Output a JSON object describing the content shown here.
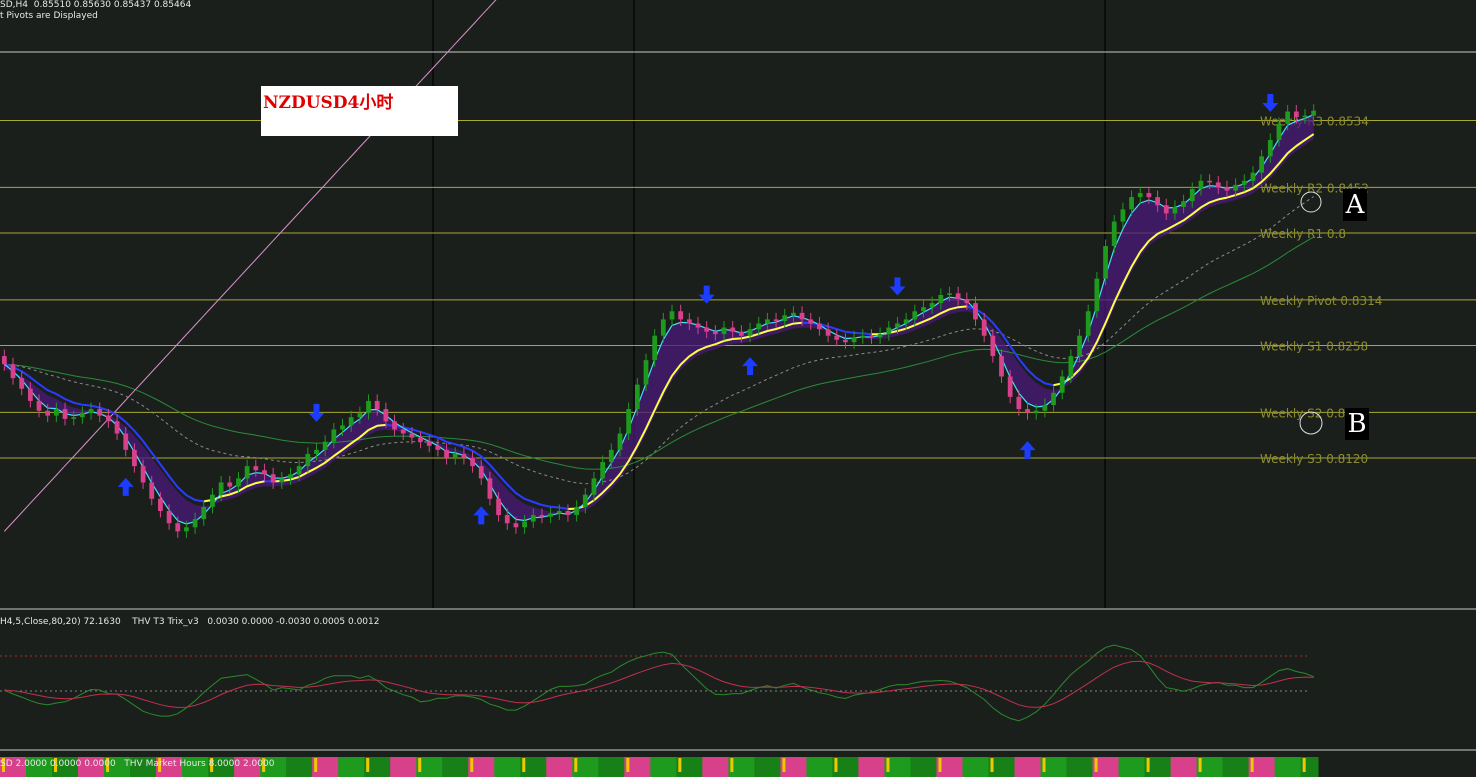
{
  "header": {
    "symbol_line": "SD,H4  0.85510 0.85630 0.85437 0.85464",
    "pivots_line": "t Pivots are Displayed",
    "indicator_line": "H4,5,Close,80,20) 72.1630    THV T3 Trix_v3   0.0030 0.0000 -0.0030 0.0005 0.0012",
    "bottom_line": "SD 2.0000 0.0000 0.0000   THV Market Hours 8.0000 2.0000"
  },
  "annotation": {
    "title": "NZDUSD4小时"
  },
  "point_labels": {
    "a": "A",
    "b": "B"
  },
  "colors": {
    "background": "#1b1f1c",
    "pivot_line": "#a8a832",
    "pivot_text": "#8c8c2e",
    "bull_candle": "#1e9a1e",
    "bear_candle": "#d8408c",
    "yellow_ma": "#ffff40",
    "blue_ma": "#2a3cff",
    "cyan_ma": "#40e0ff",
    "pink_ma": "#d890c8",
    "cloud": "#4a1a78",
    "arrow": "#1c3cff"
  },
  "chart_data": {
    "type": "candlestick",
    "timeframe": "H4",
    "price_range": [
      0.7936,
      0.8618
    ],
    "pivot_levels": [
      {
        "name": "Weekly R3",
        "label": "Weekly R3 0.8534",
        "value": 0.8534
      },
      {
        "name": "Weekly R2",
        "label": "Weekly R2 0.8452",
        "value": 0.8452
      },
      {
        "name": "Weekly R1",
        "label": "Weekly R1 0.8",
        "value": 0.8396
      },
      {
        "name": "Weekly Pivot",
        "label": "Weekly Pivot 0.8314",
        "value": 0.8314
      },
      {
        "name": "Weekly S1",
        "label": "Weekly S1 0.8258",
        "value": 0.8258
      },
      {
        "name": "Weekly S2",
        "label": "Weekly S2 0.8176",
        "value": 0.8176
      },
      {
        "name": "Weekly S3",
        "label": "Weekly S3 0.8120",
        "value": 0.812
      }
    ],
    "closes": [
      0.8235,
      0.8218,
      0.8205,
      0.819,
      0.8178,
      0.8172,
      0.818,
      0.8168,
      0.817,
      0.8175,
      0.818,
      0.8172,
      0.8165,
      0.815,
      0.813,
      0.811,
      0.809,
      0.807,
      0.8055,
      0.804,
      0.803,
      0.8035,
      0.8045,
      0.806,
      0.8075,
      0.809,
      0.8085,
      0.8095,
      0.811,
      0.8105,
      0.81,
      0.809,
      0.8095,
      0.81,
      0.811,
      0.8125,
      0.813,
      0.814,
      0.8155,
      0.816,
      0.817,
      0.8175,
      0.819,
      0.818,
      0.8165,
      0.8155,
      0.815,
      0.8145,
      0.814,
      0.8135,
      0.813,
      0.812,
      0.8125,
      0.812,
      0.811,
      0.8095,
      0.807,
      0.805,
      0.804,
      0.8035,
      0.8042,
      0.805,
      0.8048,
      0.8052,
      0.8055,
      0.805,
      0.806,
      0.8075,
      0.8095,
      0.8115,
      0.813,
      0.815,
      0.818,
      0.821,
      0.824,
      0.827,
      0.829,
      0.83,
      0.829,
      0.8285,
      0.828,
      0.8275,
      0.8272,
      0.828,
      0.8275,
      0.827,
      0.8278,
      0.8285,
      0.829,
      0.8288,
      0.8295,
      0.8298,
      0.829,
      0.8285,
      0.8278,
      0.827,
      0.8265,
      0.8262,
      0.8268,
      0.827,
      0.8268,
      0.8272,
      0.828,
      0.8285,
      0.829,
      0.83,
      0.8305,
      0.831,
      0.832,
      0.8322,
      0.8315,
      0.831,
      0.829,
      0.827,
      0.8245,
      0.822,
      0.8195,
      0.818,
      0.8175,
      0.8178,
      0.8185,
      0.82,
      0.822,
      0.8245,
      0.827,
      0.83,
      0.834,
      0.838,
      0.841,
      0.8425,
      0.844,
      0.8445,
      0.844,
      0.843,
      0.842,
      0.8428,
      0.8435,
      0.845,
      0.846,
      0.8458,
      0.8452,
      0.8448,
      0.8455,
      0.846,
      0.847,
      0.849,
      0.851,
      0.853,
      0.8545,
      0.8538,
      0.854,
      0.8546
    ],
    "arrows": [
      {
        "direction": "up",
        "bar": 14
      },
      {
        "direction": "down",
        "bar": 36
      },
      {
        "direction": "up",
        "bar": 55
      },
      {
        "direction": "down",
        "bar": 81
      },
      {
        "direction": "up",
        "bar": 86
      },
      {
        "direction": "down",
        "bar": 103
      },
      {
        "direction": "up",
        "bar": 118
      },
      {
        "direction": "down",
        "bar": 146
      }
    ]
  }
}
